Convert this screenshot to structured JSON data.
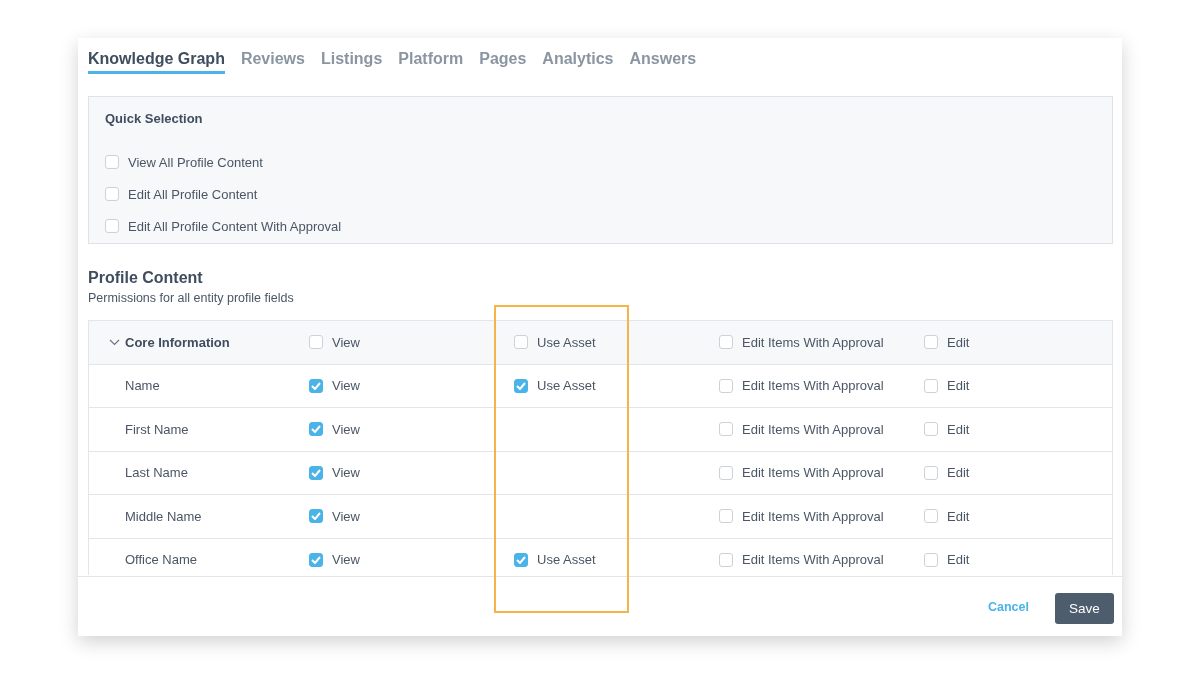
{
  "tabs": [
    {
      "label": "Knowledge Graph",
      "selected": true
    },
    {
      "label": "Reviews",
      "selected": false
    },
    {
      "label": "Listings",
      "selected": false
    },
    {
      "label": "Platform",
      "selected": false
    },
    {
      "label": "Pages",
      "selected": false
    },
    {
      "label": "Analytics",
      "selected": false
    },
    {
      "label": "Answers",
      "selected": false
    }
  ],
  "quick_selection": {
    "title": "Quick Selection",
    "options": [
      {
        "label": "View All Profile Content",
        "checked": false
      },
      {
        "label": "Edit All Profile Content",
        "checked": false
      },
      {
        "label": "Edit All Profile Content With Approval",
        "checked": false
      }
    ]
  },
  "profile_content": {
    "title": "Profile Content",
    "subtitle": "Permissions for all entity profile fields",
    "rows": [
      {
        "kind": "group",
        "name": "Core Information",
        "expanded": true,
        "view": {
          "label": "View",
          "checked": false
        },
        "use_asset": {
          "label": "Use Asset",
          "checked": false
        },
        "approval": {
          "label": "Edit Items With Approval",
          "checked": false
        },
        "edit": {
          "label": "Edit",
          "checked": false
        }
      },
      {
        "kind": "field",
        "name": "Name",
        "view": {
          "label": "View",
          "checked": true
        },
        "use_asset": {
          "label": "Use Asset",
          "checked": true
        },
        "approval": {
          "label": "Edit Items With Approval",
          "checked": false
        },
        "edit": {
          "label": "Edit",
          "checked": false
        }
      },
      {
        "kind": "field",
        "name": "First Name",
        "view": {
          "label": "View",
          "checked": true
        },
        "approval": {
          "label": "Edit Items With Approval",
          "checked": false
        },
        "edit": {
          "label": "Edit",
          "checked": false
        }
      },
      {
        "kind": "field",
        "name": "Last Name",
        "view": {
          "label": "View",
          "checked": true
        },
        "approval": {
          "label": "Edit Items With Approval",
          "checked": false
        },
        "edit": {
          "label": "Edit",
          "checked": false
        }
      },
      {
        "kind": "field",
        "name": "Middle Name",
        "view": {
          "label": "View",
          "checked": true
        },
        "approval": {
          "label": "Edit Items With Approval",
          "checked": false
        },
        "edit": {
          "label": "Edit",
          "checked": false
        }
      },
      {
        "kind": "field",
        "name": "Office Name",
        "view": {
          "label": "View",
          "checked": true
        },
        "use_asset": {
          "label": "Use Asset",
          "checked": true
        },
        "approval": {
          "label": "Edit Items With Approval",
          "checked": false
        },
        "edit": {
          "label": "Edit",
          "checked": false
        }
      }
    ]
  },
  "footer": {
    "cancel": "Cancel",
    "save": "Save"
  }
}
